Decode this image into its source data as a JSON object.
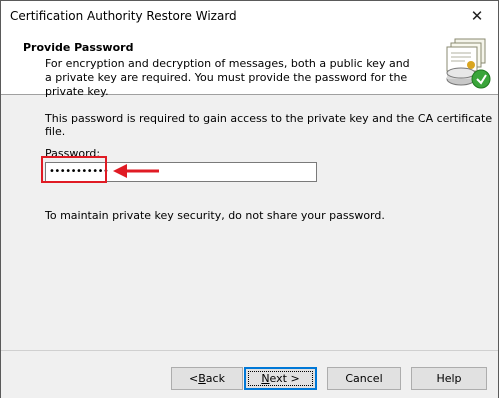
{
  "window": {
    "title": "Certification Authority Restore Wizard",
    "close_glyph": "✕"
  },
  "header": {
    "title": "Provide Password",
    "description": "For encryption and decryption of messages, both a public key and a private key are required. You must provide the password for the private key.",
    "icon": "certificate-restore-icon"
  },
  "content": {
    "info": "This password is required to gain access to the private key and the CA certificate file.",
    "password_label": "Password:",
    "password_value": "•••••••••••",
    "security_note": "To maintain private key security, do not share your password."
  },
  "annotation": {
    "color": "#e01b24"
  },
  "buttons": {
    "back_prefix": "< ",
    "back_mnemonic": "B",
    "back_rest": "ack",
    "next_mnemonic": "N",
    "next_rest": "ext >",
    "cancel": "Cancel",
    "help": "Help"
  }
}
